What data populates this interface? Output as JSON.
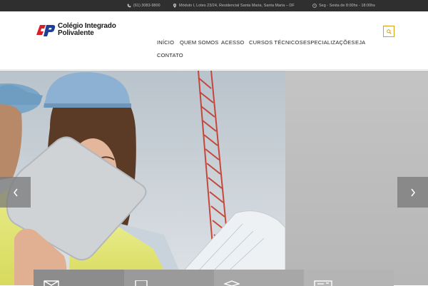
{
  "topbar": {
    "phone": "(61) 3083-9800",
    "address": "Módulo I, Lotes 23/24, Residencial Santa Maria, Santa Maria – DF",
    "hours": "Seg - Sexta de 8:00hs - 18:00hs"
  },
  "logo": {
    "line1": "Colégio Integrado",
    "line2": "Polivalente"
  },
  "nav": {
    "items": [
      {
        "label": "INÍCIO"
      },
      {
        "label": "QUEM SOMOS"
      },
      {
        "label": "ACESSO"
      },
      {
        "label": "CURSOS TÉCNICOS"
      },
      {
        "label": "ESPECIALIZAÇÕES"
      },
      {
        "label": "EJA"
      },
      {
        "label": "CONTATO"
      }
    ]
  },
  "icons": {
    "phone": "phone-icon",
    "location": "map-pin-icon",
    "clock": "clock-icon",
    "search": "search-icon",
    "prev": "chevron-left-icon",
    "next": "chevron-right-icon"
  },
  "features": [
    {
      "icon": "envelope-icon",
      "color": "#8c8c8c"
    },
    {
      "icon": "mobile-icon",
      "color": "#9a9a9a"
    },
    {
      "icon": "graduation-cap-icon",
      "color": "#a7a7a7"
    },
    {
      "icon": "certificate-icon",
      "color": "#b4b4b4"
    }
  ],
  "colors": {
    "accent": "#d4a017",
    "topbar": "#2f2f2f",
    "logo_red": "#d62027",
    "logo_blue": "#1c3f94"
  }
}
